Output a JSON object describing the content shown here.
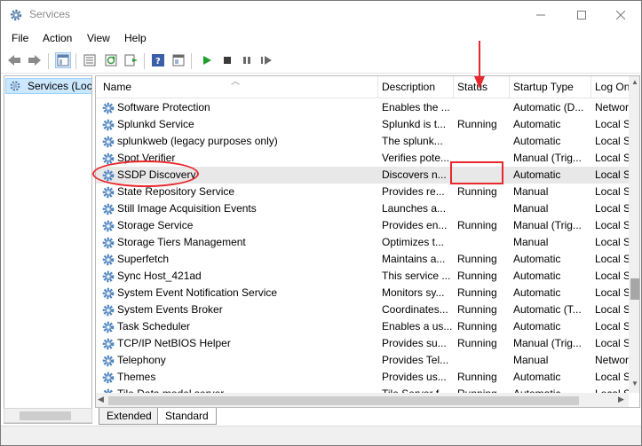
{
  "window": {
    "title": "Services"
  },
  "menu": [
    "File",
    "Action",
    "View",
    "Help"
  ],
  "toolbar": {
    "buttons": [
      "back-icon",
      "forward-icon",
      "show-hide-tree-icon",
      "properties-icon",
      "refresh-icon",
      "export-list-icon",
      "help-icon",
      "console-view-icon",
      "start-service-icon",
      "stop-service-icon",
      "pause-service-icon",
      "restart-service-icon"
    ]
  },
  "tree": {
    "item_label": "Services (Local)"
  },
  "table": {
    "columns": [
      "Name",
      "Description",
      "Status",
      "Startup Type",
      "Log On As"
    ],
    "rows": [
      {
        "name": "Software Protection",
        "description": "Enables the ...",
        "status": "",
        "startup": "Automatic (D...",
        "logon": "Network..."
      },
      {
        "name": "Splunkd Service",
        "description": "Splunkd is t...",
        "status": "Running",
        "startup": "Automatic",
        "logon": "Local S..."
      },
      {
        "name": "splunkweb (legacy purposes only)",
        "description": "The splunk...",
        "status": "",
        "startup": "Automatic",
        "logon": "Local S..."
      },
      {
        "name": "Spot Verifier",
        "description": "Verifies pote...",
        "status": "",
        "startup": "Manual (Trig...",
        "logon": "Local S..."
      },
      {
        "name": "SSDP Discovery",
        "description": "Discovers n...",
        "status": "",
        "startup": "Automatic",
        "logon": "Local S..."
      },
      {
        "name": "State Repository Service",
        "description": "Provides re...",
        "status": "Running",
        "startup": "Manual",
        "logon": "Local S..."
      },
      {
        "name": "Still Image Acquisition Events",
        "description": "Launches a...",
        "status": "",
        "startup": "Manual",
        "logon": "Local S..."
      },
      {
        "name": "Storage Service",
        "description": "Provides en...",
        "status": "Running",
        "startup": "Manual (Trig...",
        "logon": "Local S..."
      },
      {
        "name": "Storage Tiers Management",
        "description": "Optimizes t...",
        "status": "",
        "startup": "Manual",
        "logon": "Local S..."
      },
      {
        "name": "Superfetch",
        "description": "Maintains a...",
        "status": "Running",
        "startup": "Automatic",
        "logon": "Local S..."
      },
      {
        "name": "Sync Host_421ad",
        "description": "This service ...",
        "status": "Running",
        "startup": "Automatic",
        "logon": "Local S..."
      },
      {
        "name": "System Event Notification Service",
        "description": "Monitors sy...",
        "status": "Running",
        "startup": "Automatic",
        "logon": "Local S..."
      },
      {
        "name": "System Events Broker",
        "description": "Coordinates...",
        "status": "Running",
        "startup": "Automatic (T...",
        "logon": "Local S..."
      },
      {
        "name": "Task Scheduler",
        "description": "Enables a us...",
        "status": "Running",
        "startup": "Automatic",
        "logon": "Local S..."
      },
      {
        "name": "TCP/IP NetBIOS Helper",
        "description": "Provides su...",
        "status": "Running",
        "startup": "Manual (Trig...",
        "logon": "Local S..."
      },
      {
        "name": "Telephony",
        "description": "Provides Tel...",
        "status": "",
        "startup": "Manual",
        "logon": "Network..."
      },
      {
        "name": "Themes",
        "description": "Provides us...",
        "status": "Running",
        "startup": "Automatic",
        "logon": "Local S..."
      },
      {
        "name": "Tile Data model server",
        "description": "Tile Server f...",
        "status": "Running",
        "startup": "Automatic",
        "logon": "Local S..."
      }
    ]
  },
  "tabs": [
    "Extended",
    "Standard"
  ],
  "colors": {
    "highlight_red": "#e8282c",
    "selected_row": "#e8e8e8",
    "tree_selected": "#cce8ff",
    "gear_blue": "#4a86c5"
  }
}
